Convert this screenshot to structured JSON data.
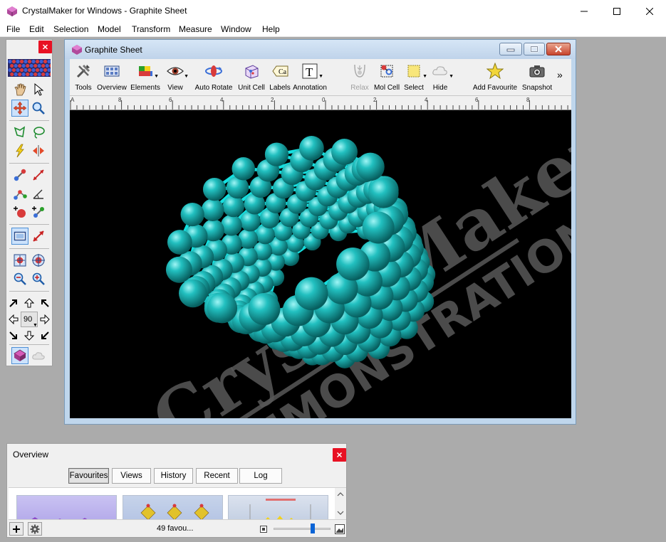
{
  "app": {
    "title": "CrystalMaker for Windows - Graphite Sheet"
  },
  "menu": [
    "File",
    "Edit",
    "Selection",
    "Model",
    "Transform",
    "Measure",
    "Window",
    "Help"
  ],
  "document": {
    "title": "Graphite Sheet",
    "toolbar": [
      {
        "label": "Tools",
        "icon": "tools-icon"
      },
      {
        "label": "Overview",
        "icon": "overview-icon"
      },
      {
        "label": "Elements",
        "icon": "elements-icon"
      },
      {
        "label": "View",
        "icon": "view-eye-icon"
      },
      {
        "label": "Auto Rotate",
        "icon": "auto-rotate-icon"
      },
      {
        "label": "Unit Cell",
        "icon": "unit-cell-icon"
      },
      {
        "label": "Labels",
        "icon": "labels-icon"
      },
      {
        "label": "Annotation",
        "icon": "annotation-icon"
      },
      {
        "label": "Relax",
        "icon": "relax-icon"
      },
      {
        "label": "Mol Cell",
        "icon": "mol-cell-icon"
      },
      {
        "label": "Select",
        "icon": "select-icon"
      },
      {
        "label": "Hide",
        "icon": "hide-icon"
      },
      {
        "label": "Add Favourite",
        "icon": "star-icon"
      },
      {
        "label": "Snapshot",
        "icon": "camera-icon"
      }
    ],
    "ruler": {
      "corner": "A",
      "ticks": [
        "8",
        "6",
        "4",
        "2",
        "0",
        "2",
        "4",
        "6",
        "8"
      ]
    },
    "watermark_text": "CrystalMaker",
    "watermark_subtext": "DEMONSTRATION"
  },
  "palette": {
    "rotation_angle": "90"
  },
  "overview": {
    "title": "Overview",
    "tabs": [
      "Favourites",
      "Views",
      "History",
      "Recent",
      "Log"
    ],
    "active_tab": "Favourites",
    "count_text": "49 favou..."
  },
  "colors": {
    "atom": "#1fb3b3",
    "bond": "#15e0e0",
    "viewport_bg": "#000000",
    "close_red": "#e81123",
    "doc_chrome": "#bfd6ec"
  }
}
